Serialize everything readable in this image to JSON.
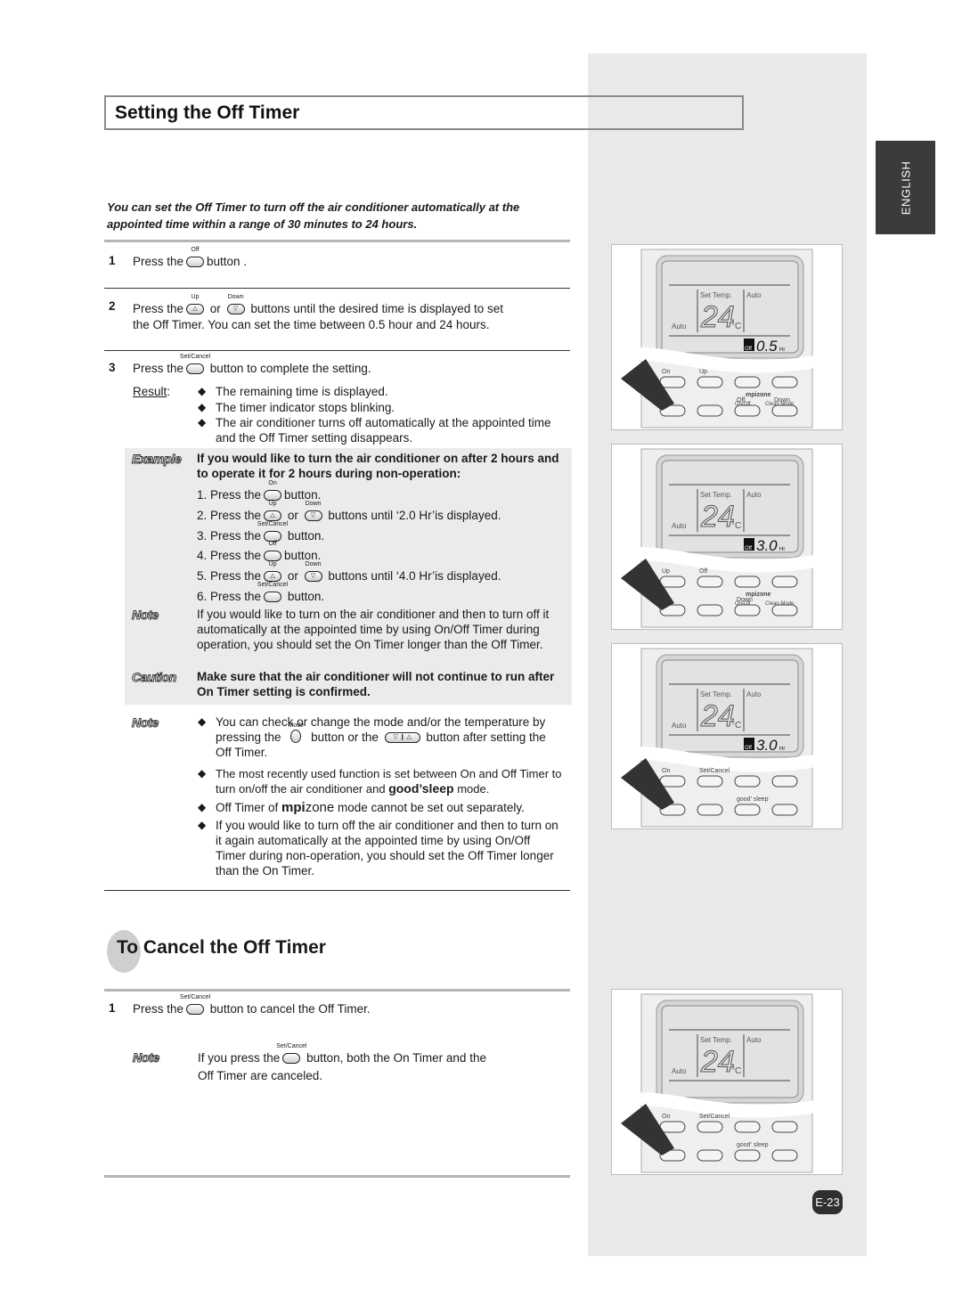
{
  "header": {
    "title": "Setting the Off Timer",
    "language_tab": "ENGLISH"
  },
  "intro": "You can set the Off Timer to turn off the air conditioner automatically at the appointed time within a range of 30 minutes to 24 hours.",
  "buttons": {
    "off": "Off",
    "on": "On",
    "up": "Up",
    "down": "Down",
    "set_cancel": "Set/Cancel",
    "mode": "Mode"
  },
  "steps": [
    {
      "num": "1",
      "pre": "Press the",
      "post": "button ."
    },
    {
      "num": "2",
      "pre": "Press the",
      "mid": "or",
      "post": "buttons until the desired time is displayed to set",
      "line2": "the Off Timer. You can set the time between 0.5 hour and 24 hours."
    },
    {
      "num": "3",
      "pre": "Press the",
      "post": "button to complete the setting."
    }
  ],
  "result": {
    "label": "Result",
    "colon": ":",
    "items": [
      "The remaining time is displayed.",
      "The timer indicator stops blinking.",
      "The air conditioner turns off automatically at the appointed time and the Off Timer setting disappears."
    ]
  },
  "example": {
    "tag": "Example",
    "heading": "If you would like to turn the air conditioner on after 2 hours and to operate it for 2 hours during non-operation:",
    "steps": [
      {
        "pre": "1. Press the",
        "post": "button."
      },
      {
        "pre": "2. Press the",
        "mid": "or",
        "post": "buttons until ‘2.0 Hr’is displayed."
      },
      {
        "pre": "3. Press the",
        "post": "button."
      },
      {
        "pre": "4. Press the",
        "post": "button."
      },
      {
        "pre": "5. Press the",
        "mid": "or",
        "post": "buttons until ‘4.0 Hr’is displayed."
      },
      {
        "pre": "6. Press the",
        "post": "button."
      }
    ]
  },
  "note1": {
    "tag": "Note",
    "text": "If you would like to turn on the air conditioner and then to turn off it automatically at the appointed time by using On/Off Timer during operation, you should set the On Timer longer than the Off Timer."
  },
  "caution": {
    "tag": "Caution",
    "text": "Make sure that the air conditioner will not continue to run after On Timer setting is confirmed."
  },
  "note2": {
    "tag": "Note",
    "b1_pre": "You can check or change the mode and/or the temperature by pressing the",
    "b1_mid": "button or the",
    "b1_post": "button after setting the Off Timer.",
    "b2_pre": "The most recently used function is set between On and Off Timer to turn on/off the air conditioner and",
    "b2_brand": "good’sleep",
    "b2_post": "mode.",
    "b3_pre": "Off Timer of",
    "b3_brand_a": "mpi",
    "b3_brand_b": "zone",
    "b3_post": "mode cannot be set out separately.",
    "b4": "If you would like to turn off the air conditioner and then to turn on it again automatically at the appointed time by using On/Off Timer during non-operation, you should set the Off Timer longer than the On Timer."
  },
  "cancel": {
    "title": "To Cancel the Off Timer",
    "step": {
      "num": "1",
      "pre": "Press the",
      "post": "button to cancel the Off Timer."
    },
    "note": {
      "tag": "Note",
      "pre": "If you press the",
      "post": "button, both the On Timer and the Off Timer are canceled."
    }
  },
  "remotes": [
    {
      "set_temp": "Set Temp.",
      "mode": "Auto",
      "fan": "Auto",
      "temp": "24",
      "unit": "°C",
      "timer_icon": "Off",
      "timer": "0.5",
      "hr": "Hr",
      "labels": [
        "On",
        "Up",
        "Off",
        "Down"
      ],
      "brand": "mpizone",
      "labels2": [
        "On/Off",
        "Clean Mode"
      ],
      "pressed": "Off"
    },
    {
      "set_temp": "Set Temp.",
      "mode": "Auto",
      "fan": "Auto",
      "temp": "24",
      "unit": "°C",
      "timer_icon": "Off",
      "timer": "3.0",
      "hr": "Hr",
      "labels": [
        "Up",
        "Off",
        "Down"
      ],
      "brand": "mpizone",
      "labels2": [
        "On/Off",
        "Clean Mode"
      ],
      "pressed": "Up"
    },
    {
      "set_temp": "Set Temp.",
      "mode": "Auto",
      "fan": "Auto",
      "temp": "24",
      "unit": "°C",
      "timer_icon": "Off",
      "timer": "3.0",
      "hr": "Hr",
      "labels": [
        "On",
        "Set/Cancel",
        "good’ sleep"
      ],
      "pressed": "Set/Cancel"
    },
    {
      "set_temp": "Set Temp.",
      "mode": "Auto",
      "fan": "Auto",
      "temp": "24",
      "unit": "°C",
      "labels": [
        "On",
        "Set/Cancel",
        "good’ sleep"
      ],
      "pressed": "Set/Cancel"
    }
  ],
  "page_number": "E-23"
}
